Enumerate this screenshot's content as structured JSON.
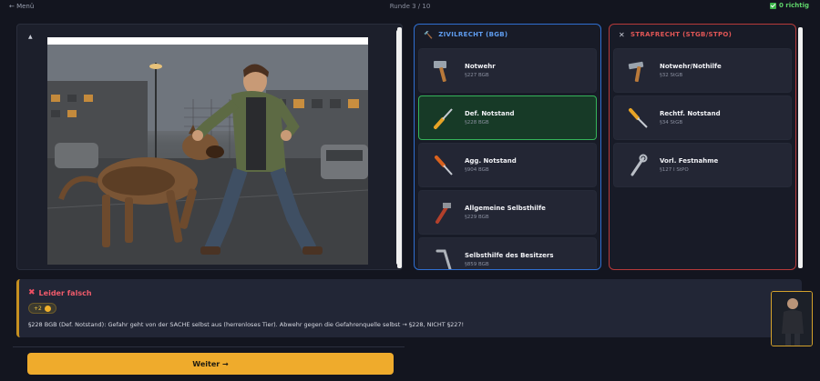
{
  "header": {
    "menu": "← Menü",
    "round": "Runde 3 / 10",
    "score": "0 richtig"
  },
  "zivil": {
    "title": "ZIVILRECHT (BGB)",
    "items": [
      {
        "label": "Notwehr",
        "ref": "§227 BGB",
        "icon": "hammer-icon"
      },
      {
        "label": "Def. Notstand",
        "ref": "§228 BGB",
        "icon": "screwdriver-icon"
      },
      {
        "label": "Agg. Notstand",
        "ref": "§904 BGB",
        "icon": "screwdriver-icon"
      },
      {
        "label": "Allgemeine Selbsthilfe",
        "ref": "§229 BGB",
        "icon": "pipe-wrench-icon"
      },
      {
        "label": "Selbsthilfe des Besitzers",
        "ref": "§859 BGB",
        "icon": "allen-key-icon"
      }
    ]
  },
  "straf": {
    "title": "STRAFRECHT (STGB/STPO)",
    "items": [
      {
        "label": "Notwehr/Nothilfe",
        "ref": "§32 StGB",
        "icon": "hammer-icon"
      },
      {
        "label": "Rechtf. Notstand",
        "ref": "§34 StGB",
        "icon": "screwdriver-icon"
      },
      {
        "label": "Vorl. Festnahme",
        "ref": "§127 I StPO",
        "icon": "wrench-icon"
      }
    ]
  },
  "result": {
    "title": "Leider falsch",
    "points": "+2",
    "explanation": "§228 BGB (Def. Notstand): Gefahr geht von der SACHE selbst aus (herrenloses Tier). Abwehr gegen die Gefahrenquelle selbst → §228, NICHT §227!"
  },
  "next_button": "Weiter →",
  "colors": {
    "accent": "#efab2c",
    "zivil_border": "#2f6fd1",
    "straf_border": "#b73a3a",
    "correct": "#35b55a",
    "wrong": "#ef5b6b"
  }
}
